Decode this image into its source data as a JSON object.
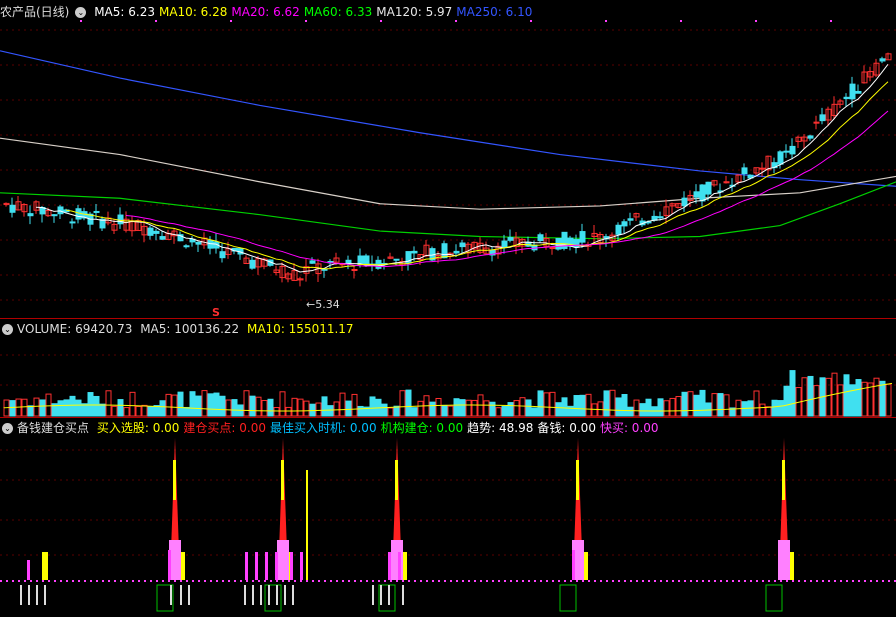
{
  "main": {
    "title": "农产品(日线)",
    "ma": [
      {
        "label": "MA5: ",
        "value": "6.23",
        "color": "#ffffff"
      },
      {
        "label": "MA10: ",
        "value": "6.28",
        "color": "#ffff00"
      },
      {
        "label": "MA20: ",
        "value": "6.62",
        "color": "#ff00ff"
      },
      {
        "label": "MA60: ",
        "value": "6.33",
        "color": "#00ff00"
      },
      {
        "label": "MA120: ",
        "value": "5.97",
        "color": "#e6e6e6"
      },
      {
        "label": "MA250: ",
        "value": "6.10",
        "color": "#3355ff"
      }
    ],
    "low_marker": "5.34",
    "signal_mark": "S"
  },
  "volume": {
    "title": "VOLUME: 69420.73",
    "ma5": "MA5: 100136.22",
    "ma10": "MA10: 155011.17"
  },
  "indicator": {
    "title": "备钱建仓买点",
    "items": [
      {
        "label": "买入选股: ",
        "value": "0.00",
        "color": "#ffff00"
      },
      {
        "label": "建仓买点: ",
        "value": "0.00",
        "color": "#ff2020"
      },
      {
        "label": "最佳买入时机: ",
        "value": "0.00",
        "color": "#00c0ff"
      },
      {
        "label": "机构建仓: ",
        "value": "0.00",
        "color": "#00ff00"
      },
      {
        "label": "趋势: ",
        "value": "48.98",
        "color": "#ffffff"
      },
      {
        "label": "备钱: ",
        "value": "0.00",
        "color": "#ffffff"
      },
      {
        "label": "快买: ",
        "value": "0.00",
        "color": "#ff40ff"
      }
    ]
  },
  "colors": {
    "up": "#ff3030",
    "down": "#40e0f0",
    "grid": "#7a0000"
  },
  "chart_data": {
    "type": "candlestick",
    "price_range": [
      5.2,
      7.9
    ],
    "ma250_path": [
      [
        0,
        7.6
      ],
      [
        120,
        7.35
      ],
      [
        260,
        7.1
      ],
      [
        420,
        6.85
      ],
      [
        560,
        6.65
      ],
      [
        700,
        6.5
      ],
      [
        800,
        6.42
      ],
      [
        896,
        6.36
      ]
    ],
    "ma120_path": [
      [
        0,
        6.8
      ],
      [
        120,
        6.65
      ],
      [
        260,
        6.4
      ],
      [
        380,
        6.2
      ],
      [
        480,
        6.15
      ],
      [
        600,
        6.18
      ],
      [
        700,
        6.25
      ],
      [
        800,
        6.3
      ],
      [
        896,
        6.45
      ]
    ],
    "ma60_path": [
      [
        0,
        6.3
      ],
      [
        120,
        6.25
      ],
      [
        260,
        6.1
      ],
      [
        380,
        5.95
      ],
      [
        480,
        5.9
      ],
      [
        600,
        5.88
      ],
      [
        700,
        5.9
      ],
      [
        780,
        6.0
      ],
      [
        840,
        6.2
      ],
      [
        896,
        6.4
      ]
    ]
  }
}
